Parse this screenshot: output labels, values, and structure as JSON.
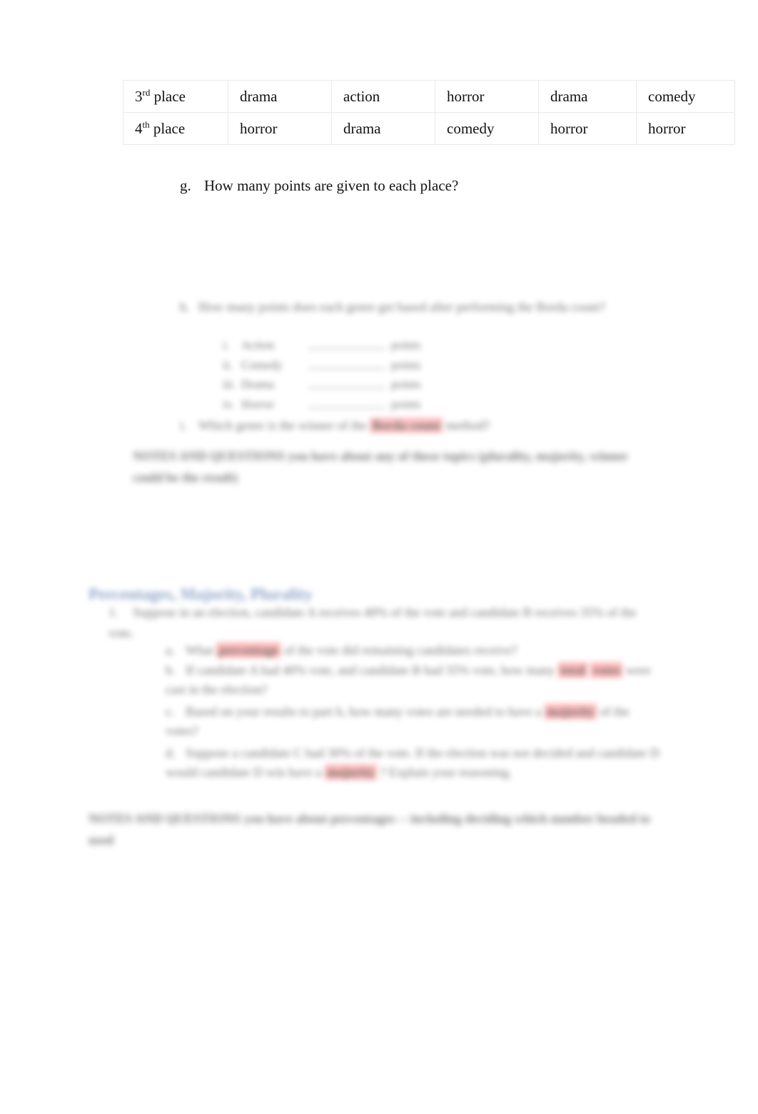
{
  "document": {
    "page_background": "#ffffff"
  },
  "colors": {
    "highlight_red": "#ff9d9d",
    "highlight_red_strong": "#ff8f8f",
    "heading_blue": "#4a6ea8",
    "table_border": "#e9e9e9",
    "text": "#121212"
  },
  "table": {
    "rows": [
      {
        "place": "3",
        "place_suffix": "rd",
        "place_word": "place",
        "cells": [
          "drama",
          "action",
          "horror",
          "drama",
          "comedy"
        ]
      },
      {
        "place": "4",
        "place_suffix": "th",
        "place_word": "place",
        "cells": [
          "horror",
          "drama",
          "comedy",
          "horror",
          "horror"
        ]
      }
    ]
  },
  "question_g": {
    "marker": "g.",
    "text": "How many points are given to each place?"
  },
  "question_h": {
    "marker": "h.",
    "text": "How many points does each genre get based after performing the Borda count?"
  },
  "points_list": [
    {
      "marker": "i.",
      "name": "Action",
      "blank": "",
      "unit": "points"
    },
    {
      "marker": "ii.",
      "name": "Comedy",
      "blank": "",
      "unit": "points"
    },
    {
      "marker": "iii.",
      "name": "Drama",
      "blank": "",
      "unit": "points"
    },
    {
      "marker": "iv.",
      "name": "Horror",
      "blank": "",
      "unit": "points"
    }
  ],
  "question_i": {
    "marker": "i.",
    "text_before": "Which genre is the winner of the",
    "highlight": "Borda count",
    "text_after": "method?"
  },
  "notes_1": {
    "text": "NOTES AND QUESTIONS you have about any of these topics (plurality, majority, winner could be the result)"
  },
  "section_heading": {
    "text": "Percentages, Majority, Plurality"
  },
  "item_1": {
    "marker": "1.",
    "text": "Suppose in an election, candidate A receives 40% of the vote and candidate B receives 35% of the vote."
  },
  "sub_questions": [
    {
      "marker": "a.",
      "before": "What",
      "highlight": "percentage",
      "after": "of the vote did remaining candidates receive?"
    },
    {
      "marker": "b.",
      "before": "If candidate A had 40% vote, and candidate B had 35% vote, how many",
      "highlight": "total",
      "highlight2": "votes",
      "after": "were cast in the election?"
    },
    {
      "marker": "c.",
      "before": "Based on your results to part b, how many votes are needed to have a",
      "highlight": "majority",
      "after": "of the votes?"
    },
    {
      "marker": "d.",
      "before": "Suppose a candidate C had 30% of the vote. If the election was not decided and candidate D would candidate D win have a",
      "highlight": "majority",
      "after": "? Explain your reasoning."
    }
  ],
  "notes_2": {
    "text": "NOTES AND QUESTIONS you have about percentages -- including deciding which number headed to used"
  }
}
